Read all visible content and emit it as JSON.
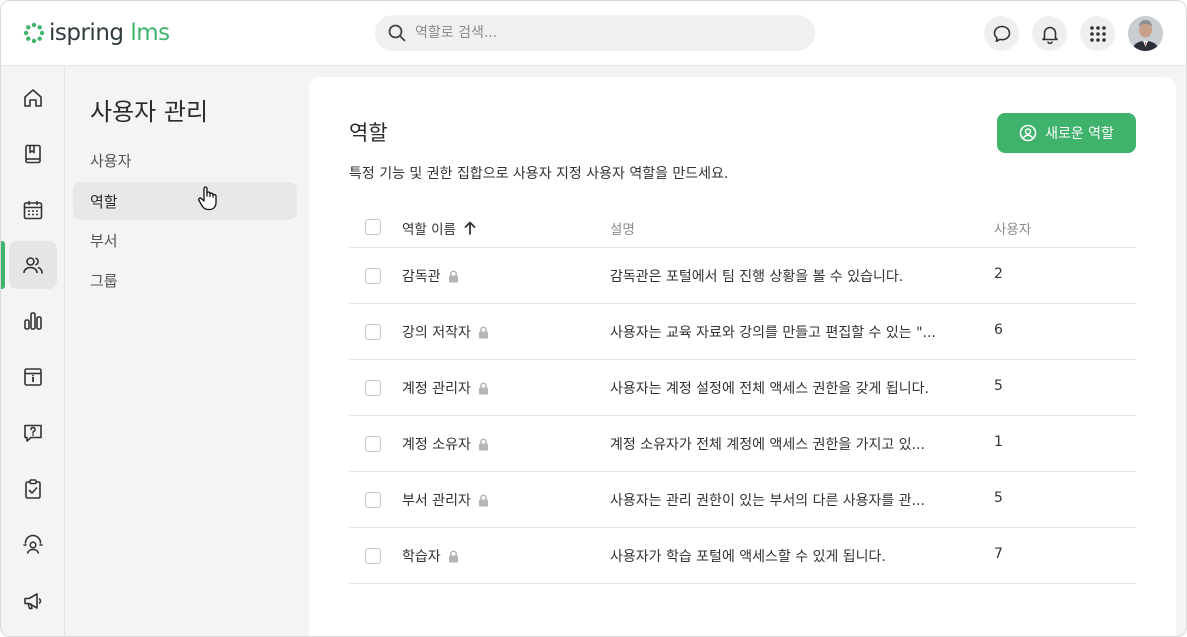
{
  "header": {
    "logo_brand": "ispring",
    "logo_product": "lms",
    "search_placeholder": "역할로 검색...",
    "icons": [
      "chat-icon",
      "bell-icon",
      "apps-grid-icon"
    ]
  },
  "rail": {
    "items": [
      "home-icon",
      "book-icon",
      "calendar-icon",
      "users-icon",
      "reports-icon",
      "info-icon",
      "help-icon",
      "assignment-icon",
      "meeting-icon",
      "megaphone-icon"
    ],
    "active_index": 3
  },
  "subnav": {
    "title": "사용자 관리",
    "items": [
      {
        "label": "사용자"
      },
      {
        "label": "역할"
      },
      {
        "label": "부서"
      },
      {
        "label": "그룹"
      }
    ],
    "active_index": 1
  },
  "main": {
    "title": "역할",
    "description": "특정 기능 및 권한 집합으로 사용자 지정 사용자 역할을 만드세요.",
    "new_button": "새로운 역할",
    "table": {
      "columns": {
        "name": "역할 이름",
        "description": "설명",
        "users": "사용자"
      },
      "sort": {
        "column": "name",
        "direction": "asc"
      },
      "rows": [
        {
          "name": "감독관",
          "locked": true,
          "description": "감독관은 포털에서 팀 진행 상황을 볼 수 있습니다.",
          "users": "2"
        },
        {
          "name": "강의 저작자",
          "locked": true,
          "description": "사용자는 교육 자료와 강의를 만들고 편집할 수 있는 \"...",
          "users": "6"
        },
        {
          "name": "계정 관리자",
          "locked": true,
          "description": "사용자는 계정 설정에 전체 액세스 권한을 갖게 됩니다.",
          "users": "5"
        },
        {
          "name": "계정 소유자",
          "locked": true,
          "description": "계정 소유자가 전체 계정에 액세스 권한을 가지고 있...",
          "users": "1"
        },
        {
          "name": "부서 관리자",
          "locked": true,
          "description": "사용자는 관리 권한이 있는 부서의 다른 사용자를 관...",
          "users": "5"
        },
        {
          "name": "학습자",
          "locked": true,
          "description": "사용자가 학습 포털에 액세스할 수 있게 됩니다.",
          "users": "7"
        }
      ]
    }
  },
  "colors": {
    "accent": "#3fb36b",
    "text": "#2b2b2b",
    "muted": "#8c8c8c"
  }
}
